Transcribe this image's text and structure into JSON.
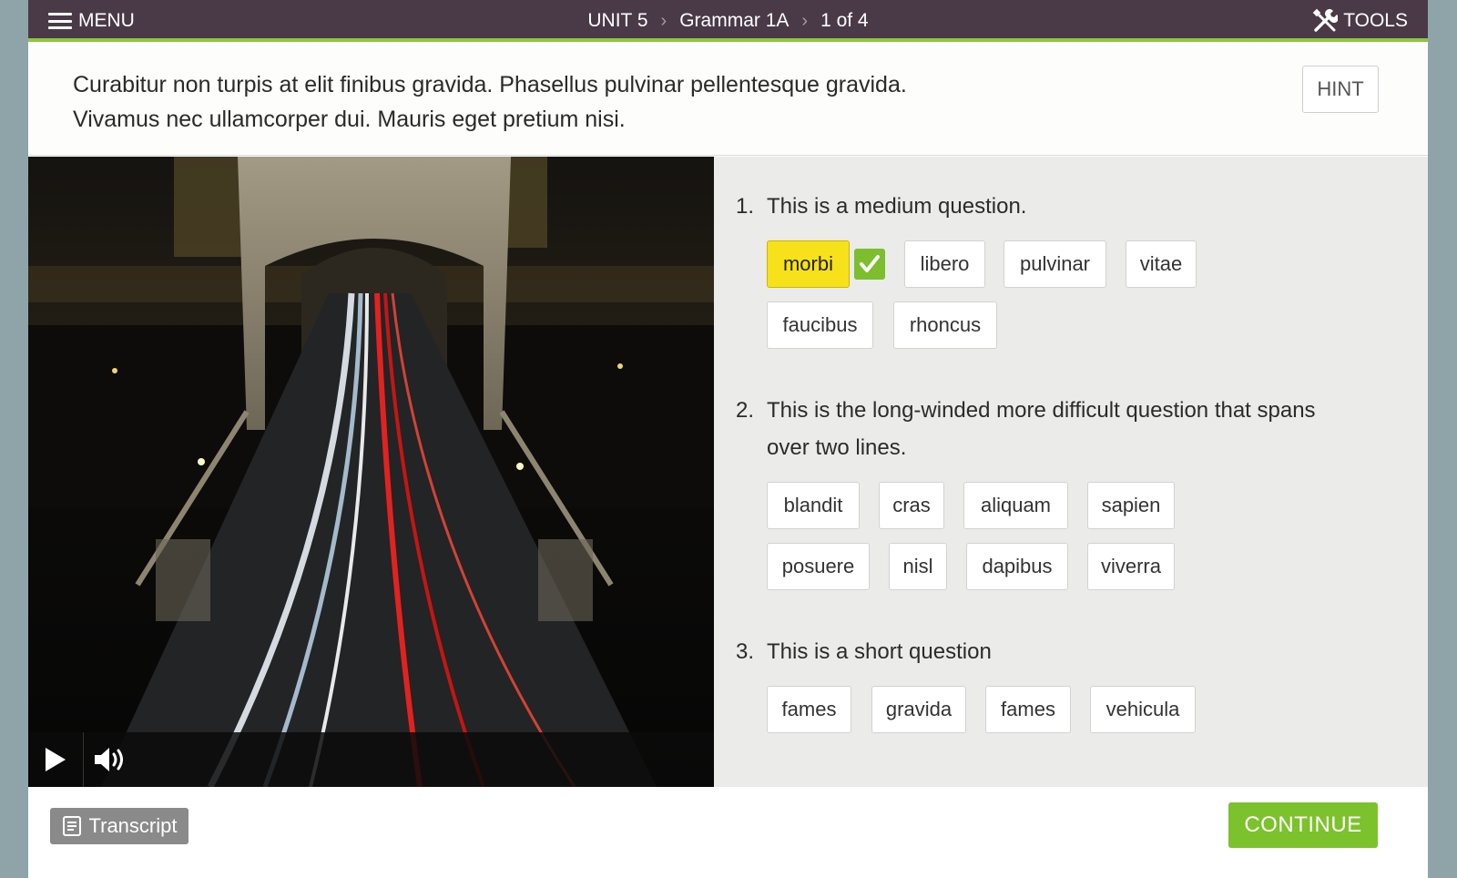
{
  "header": {
    "menu_label": "MENU",
    "breadcrumb": [
      "UNIT 5",
      "Grammar 1A",
      "1 of 4"
    ],
    "tools_label": "TOOLS"
  },
  "instruction": {
    "line1": "Curabitur non turpis at elit finibus gravida. Phasellus pulvinar pellentesque gravida.",
    "line2": "Vivamus nec ullamcorper dui. Mauris eget pretium nisi.",
    "hint_label": "HINT"
  },
  "questions": [
    {
      "number": "1.",
      "text": "This is a medium question.",
      "options": [
        "morbi",
        "libero",
        "pulvinar",
        "vitae",
        "faucibus",
        "rhoncus"
      ],
      "selected": "morbi",
      "correct": true
    },
    {
      "number": "2.",
      "text": "This is the long-winded more difficult question that spans over two lines.",
      "options": [
        "blandit",
        "cras",
        "aliquam",
        "sapien",
        "posuere",
        "nisl",
        "dapibus",
        "viverra"
      ]
    },
    {
      "number": "3.",
      "text": "This is a short question",
      "options": [
        "fames",
        "gravida",
        "fames",
        "vehicula"
      ]
    }
  ],
  "footer": {
    "transcript_label": "Transcript",
    "continue_label": "CONTINUE"
  },
  "colors": {
    "header_bg": "#4a3a48",
    "accent_green": "#8dc63f",
    "selected_yellow": "#f7e11a",
    "continue_green": "#7cc22c"
  }
}
